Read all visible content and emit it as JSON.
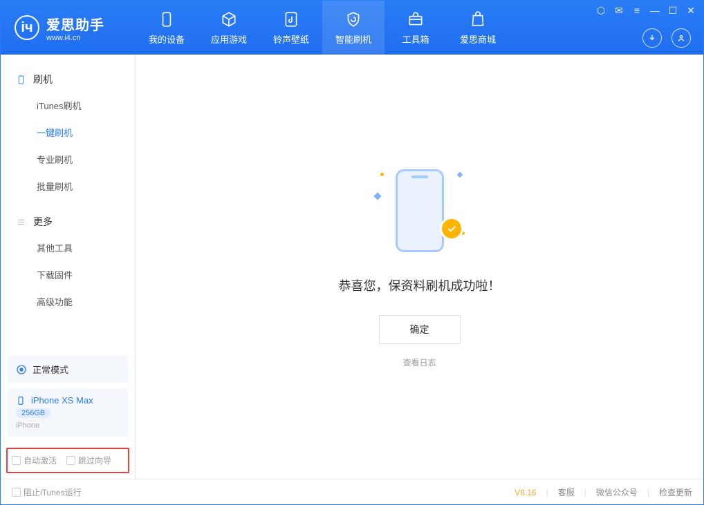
{
  "app": {
    "title": "爱思助手",
    "subtitle": "www.i4.cn"
  },
  "tabs": {
    "device": "我的设备",
    "apps": "应用游戏",
    "ringtone": "铃声壁纸",
    "flash": "智能刷机",
    "toolbox": "工具箱",
    "store": "爱思商城"
  },
  "sidebar": {
    "section_flash": "刷机",
    "items_flash": {
      "itunes": "iTunes刷机",
      "oneclick": "一键刷机",
      "pro": "专业刷机",
      "batch": "批量刷机"
    },
    "section_more": "更多",
    "items_more": {
      "other": "其他工具",
      "firmware": "下载固件",
      "advanced": "高级功能"
    }
  },
  "device_panel": {
    "mode": "正常模式",
    "name": "iPhone XS Max",
    "capacity": "256GB",
    "type": "iPhone"
  },
  "options": {
    "auto_activate": "自动激活",
    "skip_guide": "跳过向导"
  },
  "main": {
    "success_msg": "恭喜您，保资料刷机成功啦！",
    "ok": "确定",
    "view_logs": "查看日志"
  },
  "footer": {
    "block_itunes": "阻止iTunes运行",
    "version": "V8.16",
    "support": "客服",
    "wechat": "微信公众号",
    "update": "检查更新"
  }
}
